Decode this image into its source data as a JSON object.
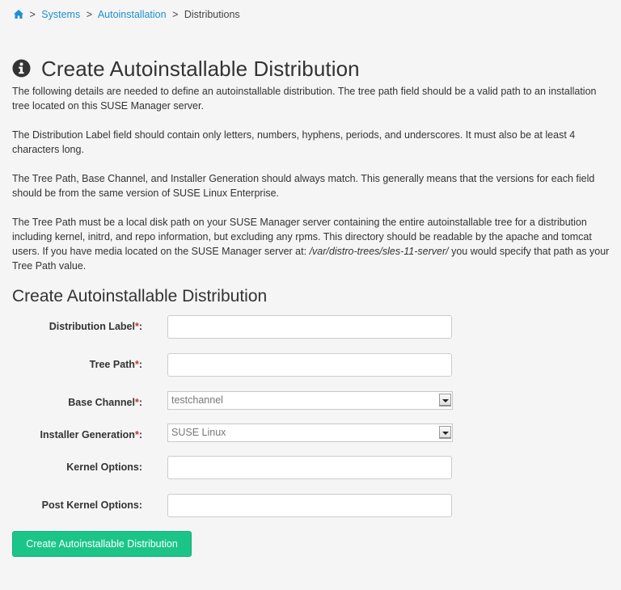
{
  "breadcrumb": {
    "home_icon": "home-icon",
    "items": [
      {
        "label": "Systems",
        "link": true
      },
      {
        "label": "Autoinstallation",
        "link": true
      },
      {
        "label": "Distributions",
        "link": false
      }
    ],
    "separator": ">"
  },
  "header": {
    "icon": "info-circle-icon",
    "title": "Create Autoinstallable Distribution"
  },
  "intro": {
    "p1": "The following details are needed to define an autoinstallable distribution. The tree path field should be a valid path to an installation tree located on this SUSE Manager server.",
    "p2": "The Distribution Label field should contain only letters, numbers, hyphens, periods, and underscores. It must also be at least 4 characters long.",
    "p3": "The Tree Path, Base Channel, and Installer Generation should always match. This generally means that the versions for each field should be from the same version of SUSE Linux Enterprise.",
    "p4_before": "The Tree Path must be a local disk path on your SUSE Manager server containing the entire autoinstallable tree for a distribution including kernel, initrd, and repo information, but excluding any rpms. This directory should be readable by the apache and tomcat users. If you have media located on the SUSE Manager server at: ",
    "p4_path": "/var/distro-trees/sles-11-server/",
    "p4_after": " you would specify that path as your Tree Path value."
  },
  "form": {
    "section_title": "Create Autoinstallable Distribution",
    "required_marker": "*",
    "colon": ":",
    "fields": {
      "distribution_label": {
        "label": "Distribution Label",
        "value": "",
        "required": true
      },
      "tree_path": {
        "label": "Tree Path",
        "value": "",
        "required": true
      },
      "base_channel": {
        "label": "Base Channel",
        "selected": "testchannel",
        "required": true
      },
      "installer_generation": {
        "label": "Installer Generation",
        "selected": "SUSE Linux",
        "required": true
      },
      "kernel_options": {
        "label": "Kernel Options",
        "value": "",
        "required": false
      },
      "post_kernel_options": {
        "label": "Post Kernel Options",
        "value": "",
        "required": false
      }
    },
    "submit_label": "Create Autoinstallable Distribution"
  },
  "colors": {
    "link": "#1e8fd0",
    "accent_button": "#1bc588",
    "required": "#c0392b",
    "background": "#f5f5f5"
  }
}
